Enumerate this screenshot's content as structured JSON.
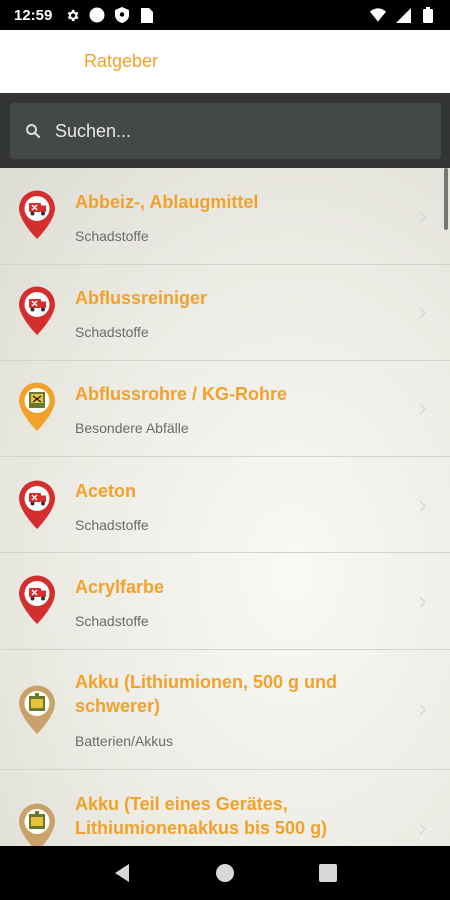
{
  "status_bar": {
    "time": "12:59",
    "left_icons": [
      "gear-icon",
      "circle-icon",
      "shield-icon",
      "sim-card-icon"
    ],
    "right_icons": [
      "wifi-icon",
      "signal-icon",
      "battery-icon"
    ]
  },
  "app_bar": {
    "title": "Ratgeber"
  },
  "search": {
    "placeholder": "Suchen..."
  },
  "items": [
    {
      "title": "Abbeiz-, Ablaugmittel",
      "subtitle": "Schadstoffe",
      "icon": "hazardous-waste-truck-pin-icon",
      "color": "#d32f2f"
    },
    {
      "title": "Abflussreiniger",
      "subtitle": "Schadstoffe",
      "icon": "hazardous-waste-truck-pin-icon",
      "color": "#d32f2f"
    },
    {
      "title": "Abflussrohre / KG-Rohre",
      "subtitle": "Besondere Abfälle",
      "icon": "special-waste-bin-pin-icon",
      "color": "#f2a12a"
    },
    {
      "title": "Aceton",
      "subtitle": "Schadstoffe",
      "icon": "hazardous-waste-truck-pin-icon",
      "color": "#d32f2f"
    },
    {
      "title": "Acrylfarbe",
      "subtitle": "Schadstoffe",
      "icon": "hazardous-waste-truck-pin-icon",
      "color": "#d32f2f"
    },
    {
      "title": "Akku (Lithiumionen, 500 g und schwerer)",
      "subtitle": "Batterien/Akkus",
      "icon": "battery-bin-pin-icon",
      "color": "#c9a26a"
    },
    {
      "title": "Akku (Teil eines Gerätes, Lithiumionenakkus bis 500 g)",
      "subtitle": "",
      "icon": "battery-bin-pin-icon",
      "color": "#c9a26a"
    }
  ],
  "colors": {
    "accent": "#f2a12a",
    "hazard": "#d32f2f",
    "battery": "#c9a26a",
    "search_bg": "#333536"
  },
  "nav_bar": {
    "icons": [
      "back-icon",
      "home-icon",
      "recents-icon"
    ]
  }
}
